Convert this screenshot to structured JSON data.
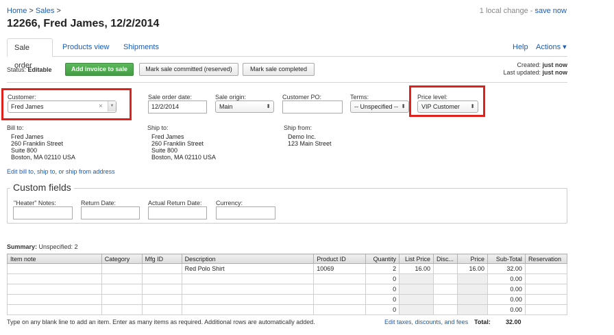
{
  "breadcrumb": {
    "home": "Home",
    "sep1": ">",
    "sales": "Sales",
    "sep2": ">"
  },
  "page_title": "12266, Fred James, 12/2/2014",
  "sync": {
    "text": "1 local change -",
    "link": "save now"
  },
  "tabs": [
    {
      "label": "Sale order"
    },
    {
      "label": "Products view"
    },
    {
      "label": "Shipments"
    }
  ],
  "tabs_right": {
    "help": "Help",
    "actions": "Actions ▾"
  },
  "status": {
    "label": "Status:",
    "value": "Editable"
  },
  "buttons": {
    "add_invoice": "Add invoice to sale",
    "mark_committed": "Mark sale committed (reserved)",
    "mark_completed": "Mark sale completed"
  },
  "created": {
    "created_label": "Created:",
    "created_value": "just now",
    "updated_label": "Last updated:",
    "updated_value": "just now"
  },
  "form": {
    "customer_label": "Customer:",
    "customer_value": "Fred James",
    "customer_clear": "×",
    "customer_drop": "▼",
    "date_label": "Sale order date:",
    "date_value": "12/2/2014",
    "origin_label": "Sale origin:",
    "origin_value": "Main",
    "po_label": "Customer PO:",
    "po_value": "",
    "terms_label": "Terms:",
    "terms_value": "-- Unspecified --",
    "price_level_label": "Price level:",
    "price_level_value": "VIP Customer",
    "select_arrow": "⬍"
  },
  "bill_to": {
    "heading": "Bill to:",
    "lines": [
      "Fred James",
      "260 Franklin Street",
      "Suite 800",
      "Boston, MA 02110 USA"
    ]
  },
  "ship_to": {
    "heading": "Ship to:",
    "lines": [
      "Fred James",
      "260 Franklin Street",
      "Suite 800",
      "Boston, MA 02110 USA"
    ]
  },
  "ship_from": {
    "heading": "Ship from:",
    "lines": [
      "Demo Inc.",
      "123 Main Street"
    ]
  },
  "edit_address_link": "Edit bill to, ship to, or ship from address",
  "custom_fields": {
    "legend": "Custom fields",
    "heater_notes_label": "\"Heater\" Notes:",
    "return_date_label": "Return Date:",
    "actual_return_date_label": "Actual Return Date:",
    "currency_label": "Currency:"
  },
  "summary": {
    "label": "Summary:",
    "value": "Unspecified: 2"
  },
  "table": {
    "columns": [
      "Item note",
      "Category",
      "Mfg ID",
      "Description",
      "Product ID",
      "Quantity",
      "List Price",
      "Disc...",
      "Price",
      "Sub-Total",
      "Reservation"
    ],
    "rows": [
      [
        "",
        "",
        "",
        "Red Polo Shirt",
        "10069",
        "2",
        "16.00",
        "",
        "16.00",
        "32.00",
        ""
      ],
      [
        "",
        "",
        "",
        "",
        "",
        "0",
        "",
        "",
        "",
        "0.00",
        ""
      ],
      [
        "",
        "",
        "",
        "",
        "",
        "0",
        "",
        "",
        "",
        "0.00",
        ""
      ],
      [
        "",
        "",
        "",
        "",
        "",
        "0",
        "",
        "",
        "",
        "0.00",
        ""
      ],
      [
        "",
        "",
        "",
        "",
        "",
        "0",
        "",
        "",
        "",
        "0.00",
        ""
      ]
    ]
  },
  "footer": {
    "note": "Type on any blank line to add an item. Enter as many items as required. Additional rows are automatically added.",
    "edit_taxes": "Edit taxes, discounts, and fees",
    "total_label": "Total:",
    "total_value": "32.00"
  },
  "colors": {
    "link": "#1a5bb5",
    "highlight_box": "#e0201b",
    "green_button": "#449d44"
  }
}
